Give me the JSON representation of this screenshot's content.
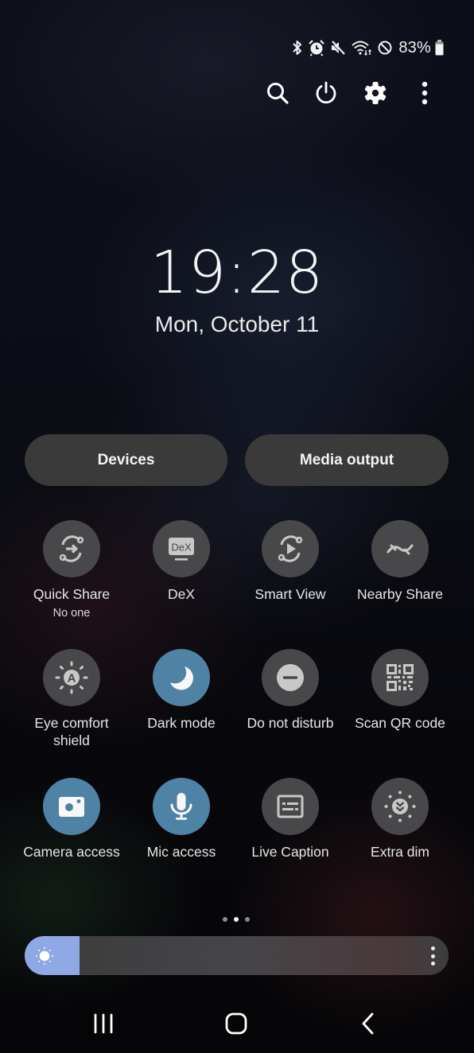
{
  "status_bar": {
    "icons": [
      "bluetooth-icon",
      "alarm-icon",
      "mute-icon",
      "wifi-icon",
      "do-not-disturb-icon",
      "battery-icon"
    ],
    "battery_percent": "83%"
  },
  "top_actions": [
    {
      "name": "search",
      "icon": "search-icon"
    },
    {
      "name": "power",
      "icon": "power-icon"
    },
    {
      "name": "settings",
      "icon": "gear-icon"
    },
    {
      "name": "more",
      "icon": "more-vert-icon"
    }
  ],
  "clock": {
    "time": "19:28",
    "date": "Mon, October 11"
  },
  "buttons": {
    "devices": "Devices",
    "media_output": "Media output"
  },
  "tiles": [
    {
      "label": "Quick Share",
      "sub": "No one",
      "icon": "quick-share-icon",
      "active": false
    },
    {
      "label": "DeX",
      "icon": "dex-icon",
      "icon_text": "DeX",
      "active": false
    },
    {
      "label": "Smart View",
      "icon": "smart-view-icon",
      "active": false
    },
    {
      "label": "Nearby Share",
      "icon": "nearby-share-icon",
      "active": false
    },
    {
      "label": "Eye comfort shield",
      "icon": "eye-comfort-icon",
      "icon_text": "A",
      "active": false
    },
    {
      "label": "Dark mode",
      "icon": "moon-icon",
      "active": true
    },
    {
      "label": "Do not disturb",
      "icon": "do-not-disturb-icon",
      "active": false
    },
    {
      "label": "Scan QR code",
      "icon": "qr-code-icon",
      "active": false
    },
    {
      "label": "Camera access",
      "icon": "camera-icon",
      "active": true
    },
    {
      "label": "Mic access",
      "icon": "mic-icon",
      "active": true
    },
    {
      "label": "Live Caption",
      "icon": "caption-icon",
      "active": false
    },
    {
      "label": "Extra dim",
      "icon": "extra-dim-icon",
      "active": false
    }
  ],
  "pager": {
    "pages": 3,
    "current": 2
  },
  "brightness": {
    "level_percent": 13
  },
  "colors": {
    "tile_active": "#4f83a6",
    "tile_inactive": "#48484b",
    "brightness_fill": "#8fa9e6",
    "pill_bg": "#3a3a3b"
  },
  "navbar": [
    {
      "name": "recents",
      "icon": "recents-icon"
    },
    {
      "name": "home",
      "icon": "home-icon"
    },
    {
      "name": "back",
      "icon": "back-icon"
    }
  ]
}
